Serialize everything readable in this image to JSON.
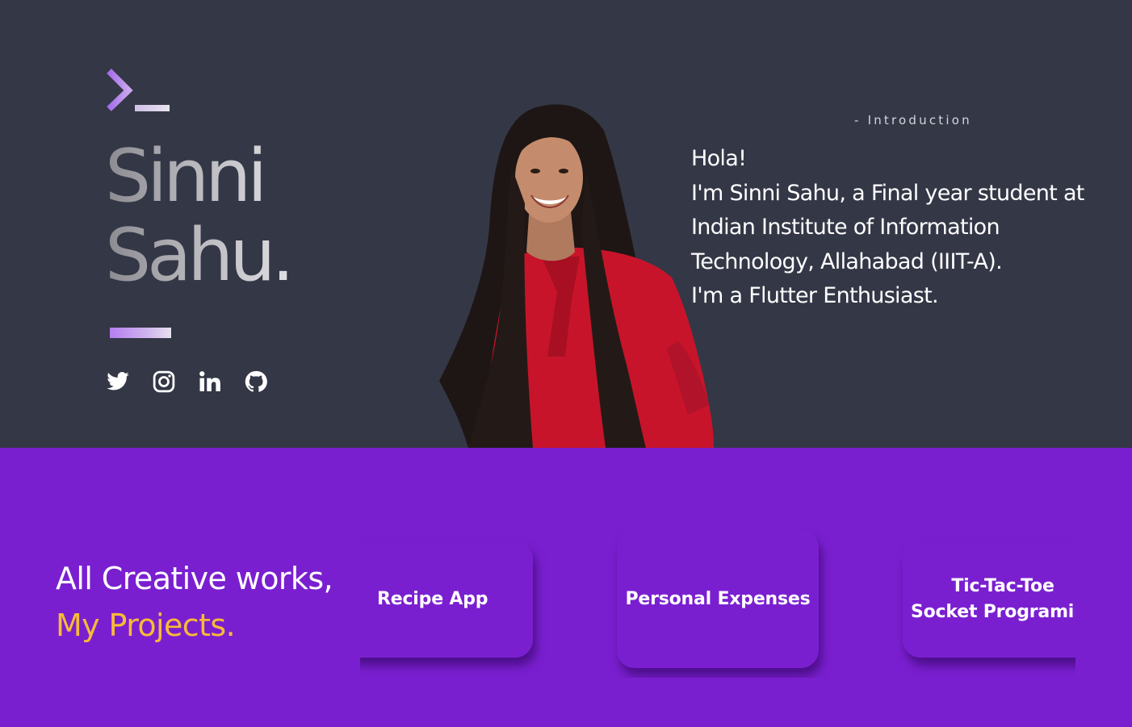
{
  "hero": {
    "first_name": "Sinni",
    "last_name": "Sahu.",
    "socials": [
      {
        "icon": "twitter-icon"
      },
      {
        "icon": "instagram-icon"
      },
      {
        "icon": "linkedin-icon"
      },
      {
        "icon": "github-icon"
      }
    ],
    "photo": "portrait-photo"
  },
  "intro": {
    "tag": "- Introduction",
    "lines": [
      "Hola!",
      "I'm Sinni Sahu, a Final year student at",
      "Indian Institute of Information",
      "Technology, Allahabad (IIIT-A).",
      "I'm a Flutter Enthusiast."
    ]
  },
  "projects_section": {
    "heading_line1": "All Creative works,",
    "heading_line2": "My Projects.",
    "cards": [
      {
        "label": "Recipe App"
      },
      {
        "label": "Personal Expenses"
      },
      {
        "line1": "Tic-Tac-Toe",
        "line2": "Socket Programing"
      }
    ]
  },
  "colors": {
    "hero_bg": "#343746",
    "projects_bg": "#7a1fd0",
    "accent_yellow": "#f7bb37",
    "logo_purple": "#b47ef0"
  }
}
